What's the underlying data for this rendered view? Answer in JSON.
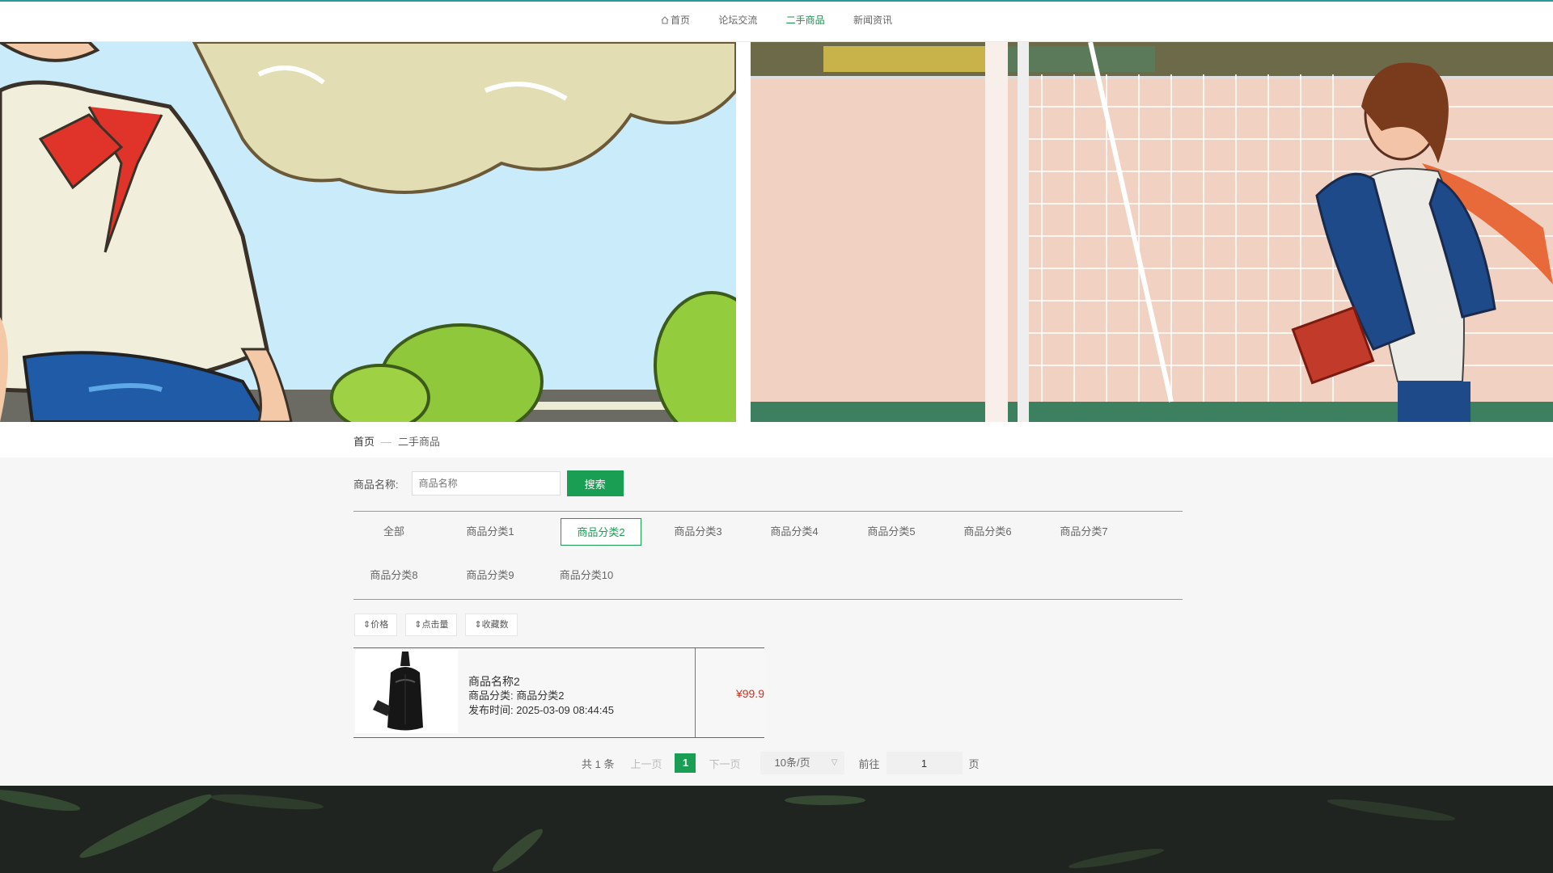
{
  "nav": {
    "items": [
      {
        "label": "首页",
        "icon": "home-icon"
      },
      {
        "label": "论坛交流"
      },
      {
        "label": "二手商品",
        "active": true
      },
      {
        "label": "新闻资讯"
      }
    ]
  },
  "breadcrumb": {
    "home": "首页",
    "separator": "—",
    "current": "二手商品"
  },
  "search": {
    "label": "商品名称:",
    "placeholder": "商品名称",
    "button": "搜索"
  },
  "categories": [
    "全部",
    "商品分类1",
    "商品分类2",
    "商品分类3",
    "商品分类4",
    "商品分类5",
    "商品分类6",
    "商品分类7",
    "商品分类8",
    "商品分类9",
    "商品分类10"
  ],
  "active_category": "商品分类2",
  "sort": [
    "价格",
    "点击量",
    "收藏数"
  ],
  "product": {
    "name": "商品名称2",
    "category_label": "商品分类:",
    "category": "商品分类2",
    "time_label": "发布时间:",
    "time": "2025-03-09 08:44:45",
    "price": "¥99.9"
  },
  "pager": {
    "total": "共 1 条",
    "prev": "上一页",
    "current": "1",
    "next": "下一页",
    "page_size": "10条/页",
    "goto": "前往",
    "goto_value": "1",
    "unit": "页"
  },
  "colors": {
    "accent": "#1a9e54",
    "price": "#c0392b",
    "footer": "#202420"
  }
}
